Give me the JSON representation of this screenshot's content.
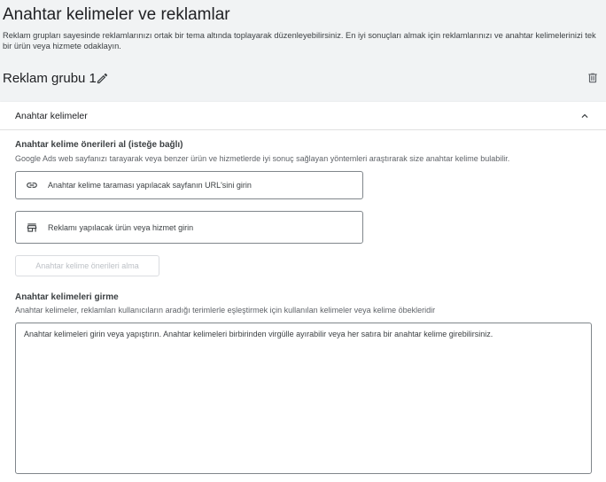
{
  "page": {
    "title": "Anahtar kelimeler ve reklamlar",
    "description": "Reklam grupları sayesinde reklamlarınızı ortak bir tema altında toplayarak düzenleyebilirsiniz. En iyi sonuçları almak için reklamlarınızı ve anahtar kelimelerinizi tek bir ürün veya hizmete odaklayın."
  },
  "ad_group": {
    "name": "Reklam grubu 1",
    "edit_icon": "pencil-icon",
    "delete_icon": "trash-icon"
  },
  "keywords_panel": {
    "title": "Anahtar kelimeler",
    "collapse_icon": "chevron-up-icon",
    "suggestions": {
      "title": "Anahtar kelime önerileri al (isteğe bağlı)",
      "description": "Google Ads web sayfanızı tarayarak veya benzer ürün ve hizmetlerde iyi sonuç sağlayan yöntemleri araştırarak size anahtar kelime bulabilir.",
      "url_field": {
        "icon": "link-icon",
        "placeholder": "Anahtar kelime taraması yapılacak sayfanın URL'sini girin",
        "value": ""
      },
      "product_field": {
        "icon": "store-icon",
        "placeholder": "Reklamı yapılacak ürün veya hizmet girin",
        "value": ""
      },
      "get_button_label": "Anahtar kelime önerileri alma"
    },
    "enter_keywords": {
      "title": "Anahtar kelimeleri girme",
      "description": "Anahtar kelimeler, reklamları kullanıcıların aradığı terimlerle eşleştirmek için kullanılan kelimeler veya kelime öbekleridir",
      "textarea_placeholder": "Anahtar kelimeleri girin veya yapıştırın. Anahtar kelimeleri birbirinden virgülle ayırabilir veya her satıra bir anahtar kelime girebilirsiniz.",
      "textarea_value": ""
    }
  },
  "colors": {
    "page_bg": "#f1f3f4",
    "card_bg": "#ffffff",
    "border": "#80868b",
    "text": "#202124",
    "disabled_text": "#bdc1c6"
  }
}
